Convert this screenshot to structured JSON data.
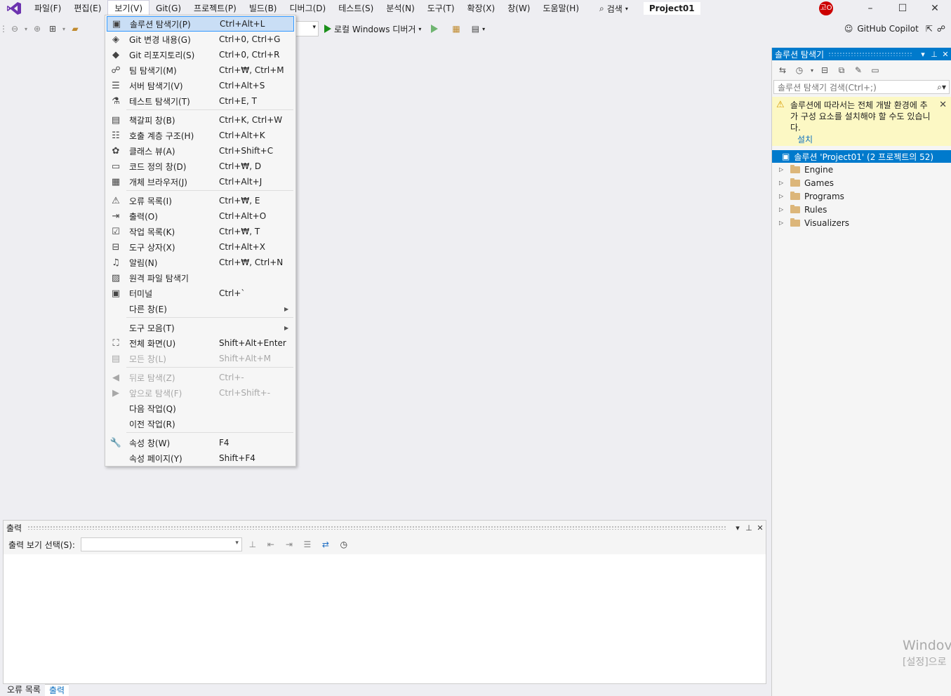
{
  "menubar": {
    "items": [
      "파일(F)",
      "편집(E)",
      "보기(V)",
      "Git(G)",
      "프로젝트(P)",
      "빌드(B)",
      "디버그(D)",
      "테스트(S)",
      "분석(N)",
      "도구(T)",
      "확장(X)",
      "창(W)",
      "도움말(H)"
    ],
    "search_label": "검색",
    "project_name": "Project01",
    "avatar_text": "고O"
  },
  "toolbar": {
    "run_label": "로컬 Windows 디버거",
    "copilot_label": "GitHub Copilot"
  },
  "view_menu": {
    "items": [
      {
        "icon": "solution-explorer-icon",
        "glyph": "▣",
        "label": "솔루션 탐색기(P)",
        "shortcut": "Ctrl+Alt+L",
        "highlighted": true
      },
      {
        "icon": "git-changes-icon",
        "glyph": "◈",
        "label": "Git 변경 내용(G)",
        "shortcut": "Ctrl+0, Ctrl+G"
      },
      {
        "icon": "git-repository-icon",
        "glyph": "◆",
        "label": "Git 리포지토리(S)",
        "shortcut": "Ctrl+0, Ctrl+R"
      },
      {
        "icon": "team-explorer-icon",
        "glyph": "☍",
        "label": "팀 탐색기(M)",
        "shortcut": "Ctrl+₩, Ctrl+M"
      },
      {
        "icon": "server-explorer-icon",
        "glyph": "☰",
        "label": "서버 탐색기(V)",
        "shortcut": "Ctrl+Alt+S"
      },
      {
        "icon": "test-explorer-icon",
        "glyph": "⚗",
        "label": "테스트 탐색기(T)",
        "shortcut": "Ctrl+E, T"
      },
      {
        "icon": "bookmark-window-icon",
        "glyph": "▤",
        "label": "책갈피 창(B)",
        "shortcut": "Ctrl+K, Ctrl+W"
      },
      {
        "icon": "call-hierarchy-icon",
        "glyph": "☷",
        "label": "호출 계층 구조(H)",
        "shortcut": "Ctrl+Alt+K"
      },
      {
        "icon": "class-view-icon",
        "glyph": "✿",
        "label": "클래스 뷰(A)",
        "shortcut": "Ctrl+Shift+C"
      },
      {
        "icon": "code-definition-icon",
        "glyph": "▭",
        "label": "코드 정의 창(D)",
        "shortcut": "Ctrl+₩, D"
      },
      {
        "icon": "object-browser-icon",
        "glyph": "▦",
        "label": "개체 브라우저(J)",
        "shortcut": "Ctrl+Alt+J"
      },
      {
        "icon": "error-list-icon",
        "glyph": "⚠",
        "label": "오류 목록(I)",
        "shortcut": "Ctrl+₩, E"
      },
      {
        "icon": "output-icon",
        "glyph": "⇥",
        "label": "출력(O)",
        "shortcut": "Ctrl+Alt+O"
      },
      {
        "icon": "task-list-icon",
        "glyph": "☑",
        "label": "작업 목록(K)",
        "shortcut": "Ctrl+₩, T"
      },
      {
        "icon": "toolbox-icon",
        "glyph": "⊟",
        "label": "도구 상자(X)",
        "shortcut": "Ctrl+Alt+X"
      },
      {
        "icon": "notification-icon",
        "glyph": "♫",
        "label": "알림(N)",
        "shortcut": "Ctrl+₩, Ctrl+N"
      },
      {
        "icon": "remote-file-icon",
        "glyph": "▨",
        "label": "원격 파일 탐색기",
        "shortcut": ""
      },
      {
        "icon": "terminal-icon",
        "glyph": "▣",
        "label": "터미널",
        "shortcut": "Ctrl+`"
      },
      {
        "icon": "",
        "glyph": "",
        "label": "다른 창(E)",
        "shortcut": "",
        "submenu": true
      },
      {
        "icon": "",
        "glyph": "",
        "label": "도구 모음(T)",
        "shortcut": "",
        "submenu": true
      },
      {
        "icon": "full-screen-icon",
        "glyph": "⛶",
        "label": "전체 화면(U)",
        "shortcut": "Shift+Alt+Enter"
      },
      {
        "icon": "all-windows-icon",
        "glyph": "▤",
        "label": "모든 창(L)",
        "shortcut": "Shift+Alt+M",
        "disabled": true
      },
      {
        "icon": "navigate-back-icon",
        "glyph": "◀",
        "label": "뒤로 탐색(Z)",
        "shortcut": "Ctrl+-",
        "disabled": true
      },
      {
        "icon": "navigate-forward-icon",
        "glyph": "▶",
        "label": "앞으로 탐색(F)",
        "shortcut": "Ctrl+Shift+-",
        "disabled": true
      },
      {
        "icon": "",
        "glyph": "",
        "label": "다음 작업(Q)",
        "shortcut": ""
      },
      {
        "icon": "",
        "glyph": "",
        "label": "이전 작업(R)",
        "shortcut": ""
      },
      {
        "icon": "properties-window-icon",
        "glyph": "🔧",
        "label": "속성 창(W)",
        "shortcut": "F4"
      },
      {
        "icon": "",
        "glyph": "",
        "label": "속성 페이지(Y)",
        "shortcut": "Shift+F4"
      }
    ]
  },
  "solution_explorer": {
    "title": "솔루션 탐색기",
    "search_placeholder": "솔루션 탐색기 검색(Ctrl+;)",
    "warning_text": "솔루션에 따라서는 전체 개발 환경에 추가 구성 요소를 설치해야 할 수도 있습니다.",
    "warning_link": "설치",
    "root_label": "솔루션 'Project01'  (2 프로젝트의 52)",
    "folders": [
      "Engine",
      "Games",
      "Programs",
      "Rules",
      "Visualizers"
    ]
  },
  "output_panel": {
    "title": "출력",
    "select_label": "출력 보기 선택(S):"
  },
  "bottom_tabs": [
    "오류 목록",
    "출력"
  ],
  "watermark": {
    "line1": "Windov",
    "line2": "[설정]으로"
  }
}
